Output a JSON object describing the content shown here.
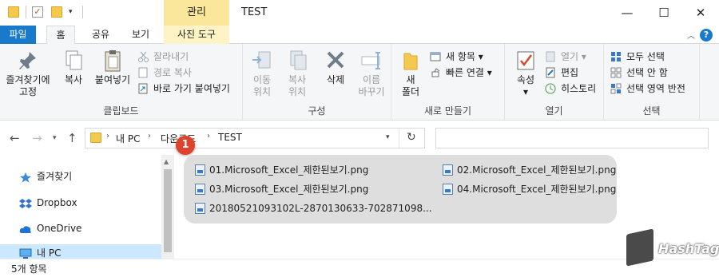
{
  "titlebar": {
    "context_tab": "관리",
    "window_title": "TEST",
    "minimize": "—",
    "maximize": "☐",
    "close": "✕"
  },
  "tabs": {
    "file": "파일",
    "home": "홈",
    "share": "공유",
    "view": "보기",
    "photo_tools": "사진 도구",
    "help": "?"
  },
  "ribbon": {
    "clipboard": {
      "label": "클립보드",
      "pin_line1": "즐겨찾기에",
      "pin_line2": "고정",
      "copy": "복사",
      "paste": "붙여넣기",
      "cut": "잘라내기",
      "copy_path": "경로 복사",
      "paste_shortcut": "바로 가기 붙여넣기"
    },
    "organize": {
      "label": "구성",
      "move_line1": "이동",
      "move_line2": "위치",
      "copy_line1": "복사",
      "copy_line2": "위치",
      "delete": "삭제",
      "rename_line1": "이름",
      "rename_line2": "바꾸기"
    },
    "new": {
      "label": "새로 만들기",
      "folder_line1": "새",
      "folder_line2": "폴더",
      "new_item": "새 항목",
      "easy_access": "빠른 연결"
    },
    "open": {
      "label": "열기",
      "properties": "속성",
      "open": "열기",
      "edit": "편집",
      "history": "히스토리"
    },
    "select": {
      "label": "선택",
      "select_all": "모두 선택",
      "select_none": "선택 안 함",
      "invert": "선택 영역 반전"
    }
  },
  "address": {
    "crumbs": [
      "내 PC",
      "다운로드",
      "TEST"
    ],
    "refresh": "↻"
  },
  "navpane": {
    "items": [
      "즐겨찾기",
      "Dropbox",
      "OneDrive",
      "내 PC"
    ]
  },
  "files": [
    "01.Microsoft_Excel_제한된보기.png",
    "02.Microsoft_Excel_제한된보기.png",
    "03.Microsoft_Excel_제한된보기.png",
    "04.Microsoft_Excel_제한된보기.png",
    "20180521093102L-2870130633-702871098..."
  ],
  "status": {
    "item_count": "5개 항목"
  },
  "badge": "1",
  "watermark": {
    "brand": "HashTag",
    "logo_text": "Hash Tag"
  },
  "colors": {
    "file_tab": "#1979ca",
    "manage_tab": "#fbe79b",
    "badge": "#e0432b"
  }
}
